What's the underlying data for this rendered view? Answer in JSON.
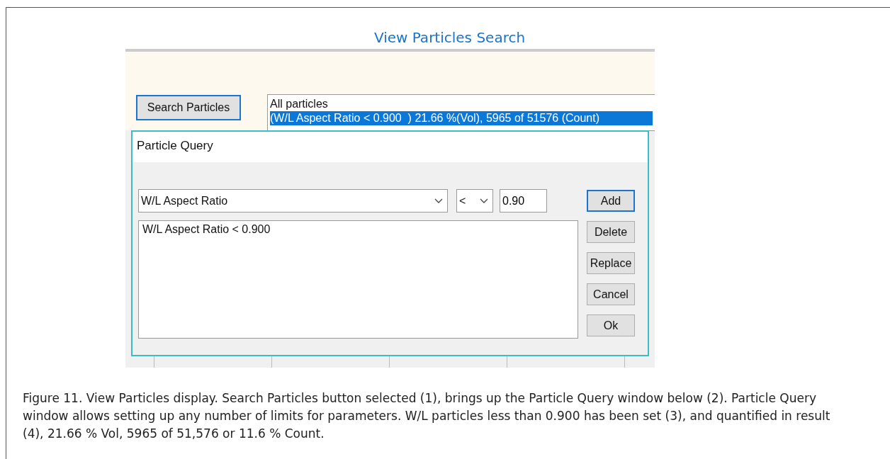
{
  "heading": "View Particles Search",
  "app": {
    "search_button": "Search Particles",
    "results": [
      {
        "text": "All particles",
        "selected": false
      },
      {
        "text": "(W/L Aspect Ratio < 0.900  ) 21.66 %(Vol), 5965 of 51576 (Count)",
        "selected": true
      }
    ]
  },
  "dialog": {
    "title": "Particle Query",
    "parameter": "W/L Aspect Ratio",
    "operator": "<",
    "value": "0.90",
    "conditions": [
      "W/L Aspect Ratio < 0.900"
    ],
    "buttons": [
      {
        "label": "Add",
        "default": true
      },
      {
        "label": "Delete",
        "default": false
      },
      {
        "label": "Replace",
        "default": false
      },
      {
        "label": "Cancel",
        "default": false
      },
      {
        "label": "Ok",
        "default": false
      }
    ]
  },
  "caption": "Figure 11. View Particles display. Search Particles button selected (1), brings up the Particle Query window below (2). Particle Query window allows setting up any number of limits for parameters. W/L particles less than 0.900 has been set (3), and quantified in result (4), 21.66 % Vol, 5965 of 51,576 or 11.6 % Count."
}
